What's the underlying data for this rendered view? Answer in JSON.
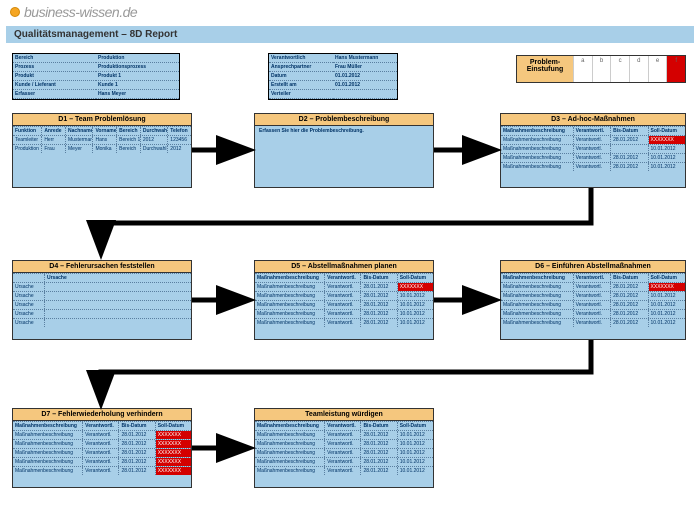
{
  "logo": {
    "text": "business-wissen.de"
  },
  "title": "Qualitätsmanagement – 8D Report",
  "meta1": {
    "r1": {
      "l": "Bereich",
      "v": "Produktion"
    },
    "r2": {
      "l": "Prozess",
      "v": "Produktionsprozess"
    },
    "r3": {
      "l": "Produkt",
      "v": "Produkt 1"
    },
    "r4": {
      "l": "Kunde / Lieferant",
      "v": "Kunde 1"
    },
    "r5": {
      "l": "Erfasser",
      "v": "Hans Meyer"
    }
  },
  "meta2": {
    "r1": {
      "l": "Verantwortlich",
      "v": "Hans Mustermann"
    },
    "r2": {
      "l": "Ansprechpartner",
      "v": "Frau Müller"
    },
    "r3": {
      "l": "Datum",
      "v": "01.01.2012"
    },
    "r4": {
      "l": "Erstellt am",
      "v": "01.01.2012"
    },
    "r5": {
      "l": "Verteiler",
      "v": ""
    }
  },
  "classification": {
    "label": "Problem-\nEinstufung",
    "c": [
      "a",
      "b",
      "c",
      "d",
      "e",
      "f"
    ]
  },
  "d1": {
    "title": "D1 – Team Problemlösung",
    "head": [
      "Funktion",
      "Anrede",
      "Nachname",
      "Vorname",
      "Bereich",
      "Durchwahl",
      "Telefon"
    ],
    "r1": [
      "Teamleiter",
      "Herr",
      "Mustermann",
      "Hans",
      "Bereich 1",
      "2012",
      "123456"
    ],
    "r2": [
      "Produktion",
      "Frau",
      "Meyer",
      "Monika",
      "Bereich",
      "Durchwahl",
      "2012"
    ]
  },
  "d2": {
    "title": "D2 – Problembeschreibung",
    "text": "Erfassen Sie hier die Problembeschreibung."
  },
  "d3": {
    "title": "D3 – Ad-hoc-Maßnahmen",
    "head": [
      "Maßnahmenbeschreibung",
      "",
      "Verantwortl.",
      "Bis-Datum",
      "Soll-Datum"
    ],
    "r1": [
      "Maßnahmenbeschreibung",
      "",
      "Verantwortl.",
      "28.01.2012",
      "XXXXXXX"
    ],
    "r2": [
      "Maßnahmenbeschreibung",
      "",
      "Verantwortl.",
      "",
      "10.01.2012"
    ],
    "r3": [
      "Maßnahmenbeschreibung",
      "",
      "Verantwortl.",
      "28.01.2012",
      "10.01.2012"
    ],
    "r4": [
      "Maßnahmenbeschreibung",
      "",
      "Verantwortl.",
      "28.01.2012",
      "10.01.2012"
    ]
  },
  "d4": {
    "title": "D4 – Fehlerursachen feststellen",
    "head": [
      "",
      "Ursache"
    ],
    "r1": "Ursache",
    "r2": "Ursache",
    "r3": "Ursache",
    "r4": "Ursache",
    "r5": "Ursache"
  },
  "d5": {
    "title": "D5 – Abstellmaßnahmen planen",
    "head": [
      "Maßnahmenbeschreibung",
      "Verantwortl.",
      "Bis-Datum",
      "Soll-Datum"
    ],
    "r1": [
      "Maßnahmenbeschreibung",
      "Verantwortl.",
      "28.01.2012",
      "XXXXXXX"
    ],
    "r2": [
      "Maßnahmenbeschreibung",
      "Verantwortl.",
      "28.01.2012",
      "10.01.2012"
    ],
    "r3": [
      "Maßnahmenbeschreibung",
      "Verantwortl.",
      "28.01.2012",
      "10.01.2012"
    ],
    "r4": [
      "Maßnahmenbeschreibung",
      "Verantwortl.",
      "28.01.2012",
      "10.01.2012"
    ],
    "r5": [
      "Maßnahmenbeschreibung",
      "Verantwortl.",
      "28.01.2012",
      "10.01.2012"
    ]
  },
  "d6": {
    "title": "D6 – Einführen Abstellmaßnahmen",
    "head": [
      "Maßnahmenbeschreibung",
      "Verantwortl.",
      "Bis-Datum",
      "Soll-Datum"
    ],
    "r1": [
      "Maßnahmenbeschreibung",
      "Verantwortl.",
      "28.01.2012",
      "XXXXXXX"
    ],
    "r2": [
      "Maßnahmenbeschreibung",
      "Verantwortl.",
      "28.01.2012",
      "10.01.2012"
    ],
    "r3": [
      "Maßnahmenbeschreibung",
      "Verantwortl.",
      "28.01.2012",
      "10.01.2012"
    ],
    "r4": [
      "Maßnahmenbeschreibung",
      "Verantwortl.",
      "28.01.2012",
      "10.01.2012"
    ],
    "r5": [
      "Maßnahmenbeschreibung",
      "Verantwortl.",
      "28.01.2012",
      "10.01.2012"
    ]
  },
  "d7": {
    "title": "D7 – Fehlerwiederholung verhindern",
    "head": [
      "Maßnahmenbeschreibung",
      "Verantwortl.",
      "Bis-Datum",
      "Soll-Datum"
    ],
    "r1": [
      "Maßnahmenbeschreibung",
      "Verantwortl.",
      "28.01.2012",
      "XXXXXXX"
    ],
    "r2": [
      "Maßnahmenbeschreibung",
      "Verantwortl.",
      "28.01.2012",
      "XXXXXXX"
    ],
    "r3": [
      "Maßnahmenbeschreibung",
      "Verantwortl.",
      "28.01.2012",
      "XXXXXXX"
    ],
    "r4": [
      "Maßnahmenbeschreibung",
      "Verantwortl.",
      "28.01.2012",
      "XXXXXXX"
    ],
    "r5": [
      "Maßnahmenbeschreibung",
      "Verantwortl.",
      "28.01.2012",
      "XXXXXXX"
    ]
  },
  "d8": {
    "title": "Teamleistung würdigen",
    "head": [
      "Maßnahmenbeschreibung",
      "Verantwortl.",
      "Bis-Datum",
      "Soll-Datum"
    ],
    "r1": [
      "Maßnahmenbeschreibung",
      "Verantwortl.",
      "28.01.2012",
      "10.01.2012"
    ],
    "r2": [
      "Maßnahmenbeschreibung",
      "Verantwortl.",
      "28.01.2012",
      "10.01.2012"
    ],
    "r3": [
      "Maßnahmenbeschreibung",
      "Verantwortl.",
      "28.01.2012",
      "10.01.2012"
    ],
    "r4": [
      "Maßnahmenbeschreibung",
      "Verantwortl.",
      "28.01.2012",
      "10.01.2012"
    ],
    "r5": [
      "Maßnahmenbeschreibung",
      "Verantwortl.",
      "28.01.2012",
      "10.01.2012"
    ]
  }
}
